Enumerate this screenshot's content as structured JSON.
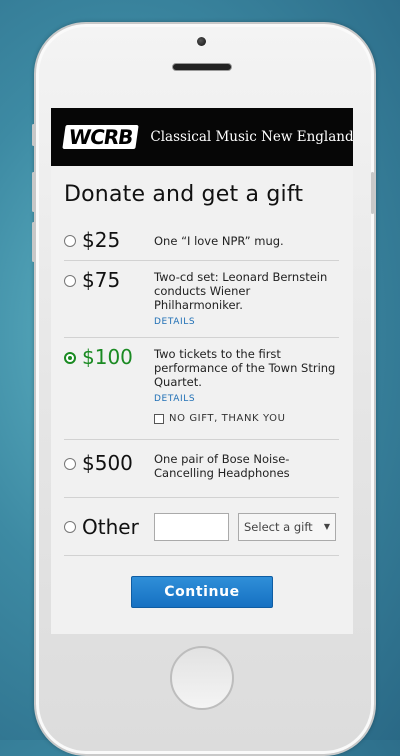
{
  "header": {
    "logo_text": "WCRB",
    "tagline": "Classical Music New England"
  },
  "title": "Donate and get a gift",
  "options": [
    {
      "amount": "$25",
      "description": "One “I love NPR” mug.",
      "selected": false
    },
    {
      "amount": "$75",
      "description": "Two-cd set: Leonard Bernstein conducts Wiener Philharmoniker.",
      "details": "DETAILS",
      "selected": false
    },
    {
      "amount": "$100",
      "description": "Two tickets to the first performance of the Town String Quartet.",
      "details": "DETAILS",
      "no_gift": "NO GIFT, THANK YOU",
      "selected": true
    },
    {
      "amount": "$500",
      "description": "One pair of Bose Noise-Cancelling Headphones",
      "selected": false
    }
  ],
  "other": {
    "label": "Other",
    "amount_value": "",
    "gift_select": "Select a gift"
  },
  "continue_label": "Continue",
  "colors": {
    "selected": "#1a8a22",
    "link": "#1f6fb5",
    "button": "#1f7dcc",
    "header_bg": "#060606"
  }
}
